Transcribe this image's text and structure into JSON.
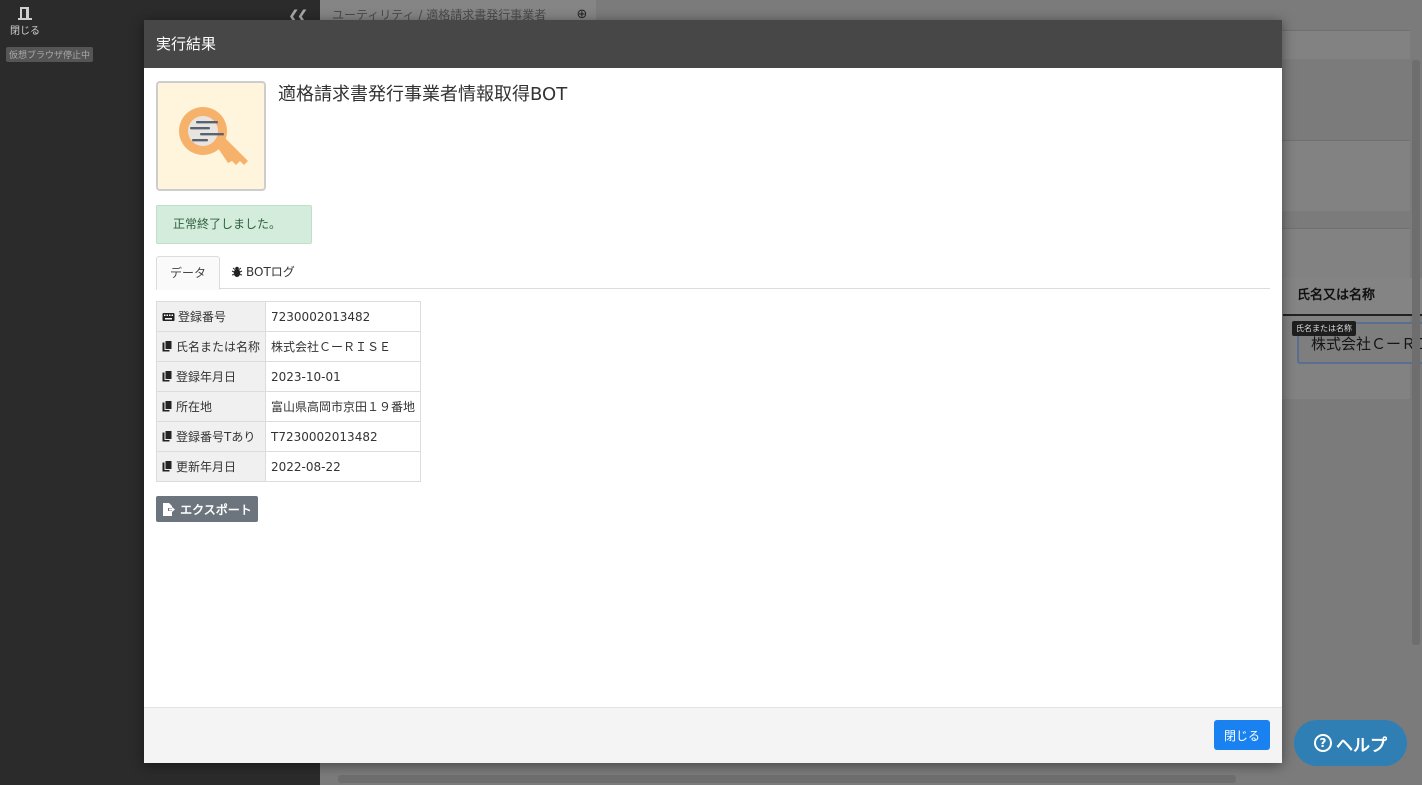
{
  "background": {
    "close_label": "閉じる",
    "virtual_browser_status": "仮想ブラウザ停止中",
    "tab_title": "ユーティリティ / 適格請求書発行事業者",
    "column_header": "氏名又は名称",
    "tooltip": "氏名または名称",
    "input_value": "株式会社ＣーＲＩＳＥ"
  },
  "help_label": "ヘルプ",
  "help_icon": "?",
  "modal": {
    "title": "実行結果",
    "bot_name": "適格請求書発行事業者情報取得BOT",
    "status_message": "正常終了しました。",
    "tabs": [
      {
        "label": "データ",
        "icon": "none"
      },
      {
        "label": "BOTログ",
        "icon": "bug-icon"
      }
    ],
    "rows": [
      {
        "label": "登録番号",
        "icon": "keyboard-icon",
        "value": "7230002013482"
      },
      {
        "label": "氏名または名称",
        "icon": "copy-icon",
        "value": "株式会社ＣーＲＩＳＥ"
      },
      {
        "label": "登録年月日",
        "icon": "copy-icon",
        "value": "2023-10-01"
      },
      {
        "label": "所在地",
        "icon": "copy-icon",
        "value": "富山県高岡市京田１９番地"
      },
      {
        "label": "登録番号Tあり",
        "icon": "copy-icon",
        "value": "T7230002013482"
      },
      {
        "label": "更新年月日",
        "icon": "copy-icon",
        "value": "2022-08-22"
      }
    ],
    "export_label": "エクスポート",
    "close_label": "閉じる"
  },
  "colors": {
    "header_bg": "#474747",
    "success_bg": "#d4ecdc",
    "primary": "#1a82f0",
    "secondary": "#6c757d",
    "help": "#2f7fb5",
    "icon_orange": "#f6b26b"
  }
}
